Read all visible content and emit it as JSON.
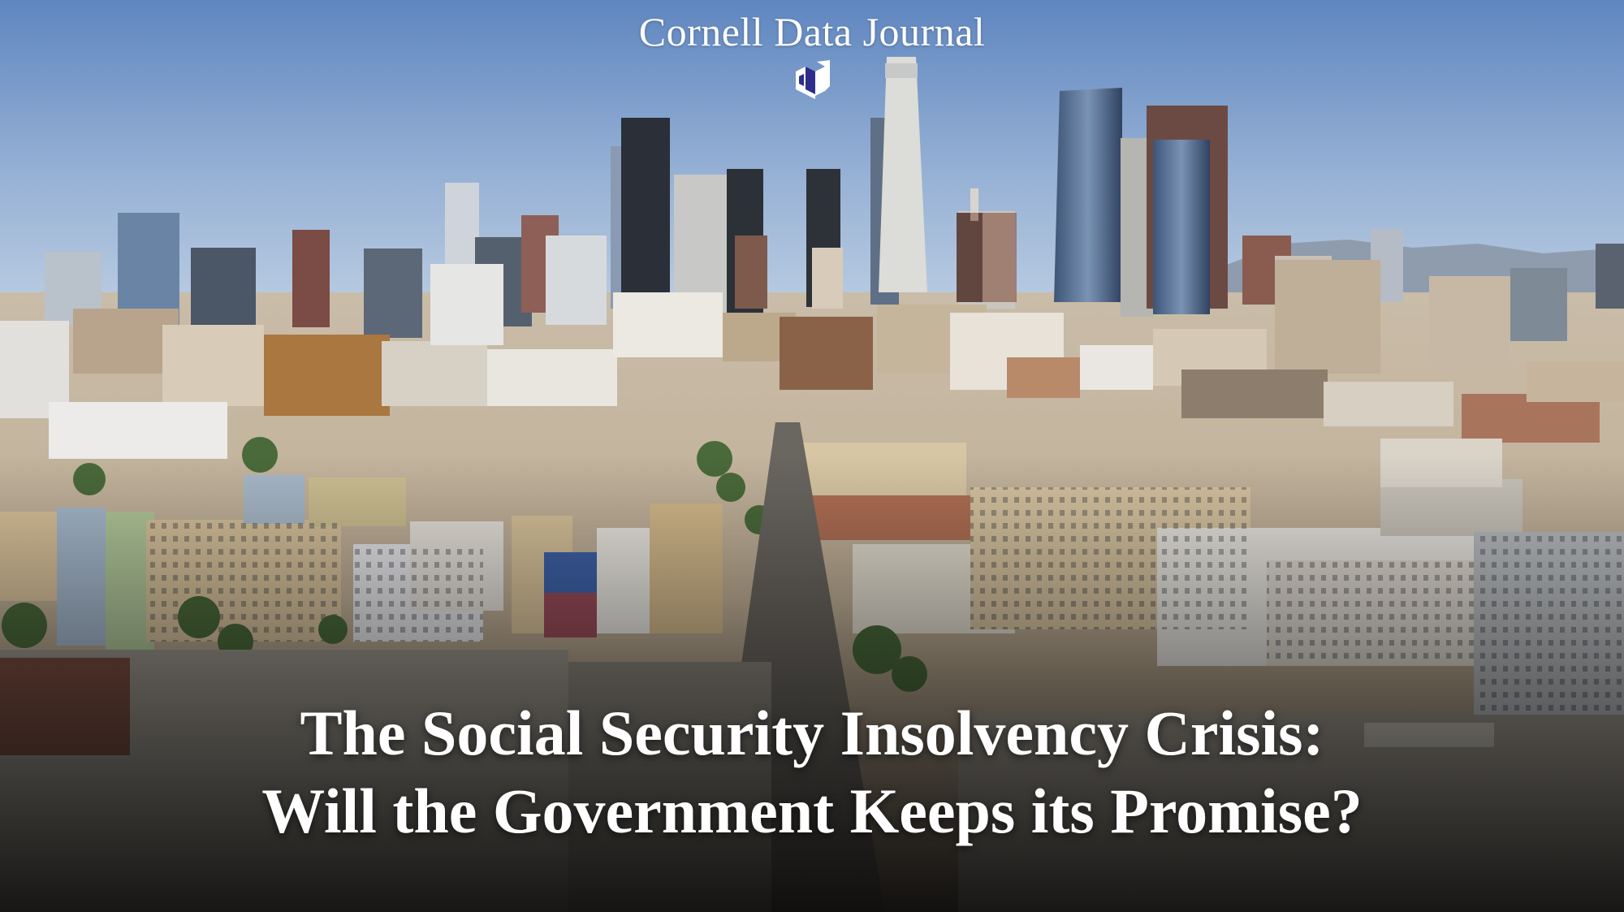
{
  "masthead": {
    "journal_name": "Cornell Data Journal",
    "logo_icon": "cdj-monogram-icon"
  },
  "headline": {
    "line1": "The Social Security Insolvency Crisis:",
    "line2": "Will the Government Keeps its Promise?"
  },
  "colors": {
    "sky_top": "#5f86c0",
    "sky_horizon": "#b8cbe2",
    "text": "#ffffff"
  }
}
